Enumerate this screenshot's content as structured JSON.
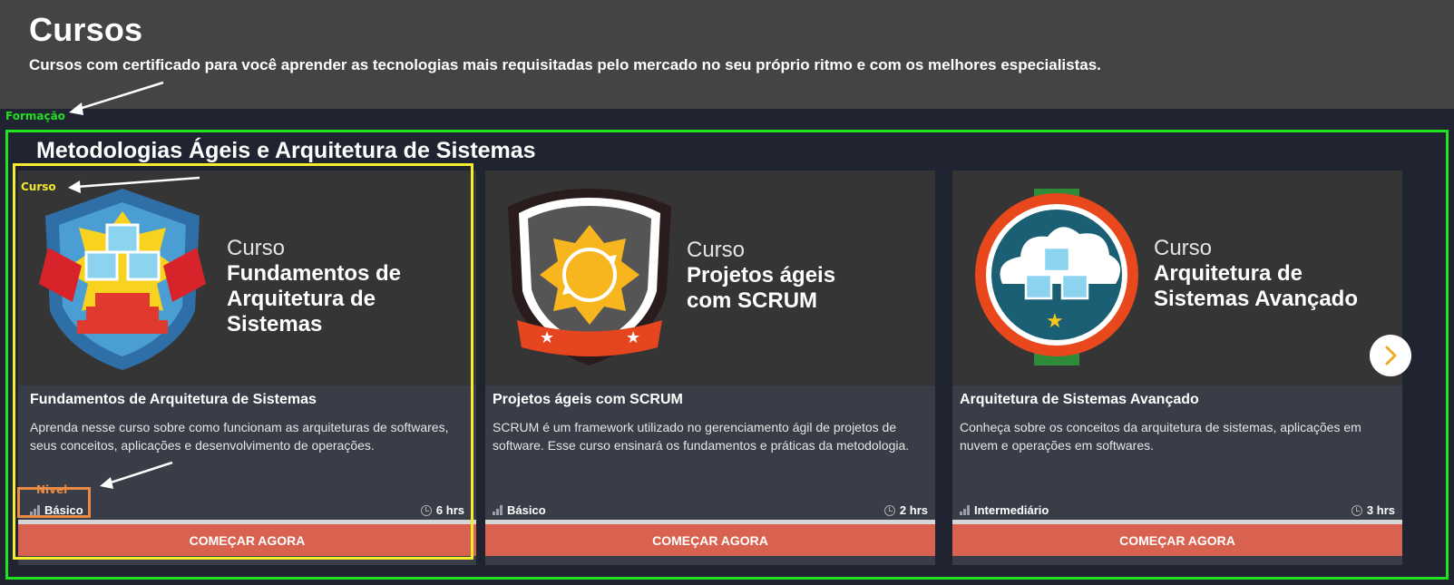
{
  "header": {
    "title": "Cursos",
    "subtitle": "Cursos com certificado para você aprender as tecnologias mais requisitadas pelo mercado no seu próprio ritmo e com os melhores especialistas."
  },
  "annotations": {
    "formacao": "Formação",
    "curso": "Curso",
    "nivel": "Nivel"
  },
  "section": {
    "title": "Metodologias Ágeis e Arquitetura de Sistemas"
  },
  "cards": [
    {
      "media_kicker": "Curso",
      "media_name": "Fundamentos de Arquitetura de Sistemas",
      "title": "Fundamentos de Arquitetura de Sistemas",
      "description": "Aprenda nesse curso sobre como funcionam as arquiteturas de softwares, seus conceitos, aplicações e desenvolvimento de operações.",
      "level": "Básico",
      "duration": "6 hrs",
      "cta": "COMEÇAR AGORA",
      "badge_icon": "architecture-shield-icon"
    },
    {
      "media_kicker": "Curso",
      "media_name": "Projetos ágeis com SCRUM",
      "title": "Projetos ágeis com SCRUM",
      "description": "SCRUM é um framework utilizado no gerenciamento ágil de projetos de software. Esse curso ensinará os fundamentos e práticas da metodologia.",
      "level": "Básico",
      "duration": "2 hrs",
      "cta": "COMEÇAR AGORA",
      "badge_icon": "scrum-shield-icon"
    },
    {
      "media_kicker": "Curso",
      "media_name": "Arquitetura de Sistemas Avançado",
      "title": "Arquitetura de Sistemas Avançado",
      "description": "Conheça sobre os conceitos da arquitetura de sistemas, aplicações em nuvem e operações em softwares.",
      "level": "Intermediário",
      "duration": "3 hrs",
      "cta": "COMEÇAR AGORA",
      "badge_icon": "cloud-architecture-badge-icon"
    }
  ],
  "colors": {
    "header_bg": "#444444",
    "page_bg": "#1f2430",
    "card_bg": "#383d48",
    "cta_bg": "#d9614f",
    "formacao_annotation": "#1ee31e",
    "curso_annotation": "#f3ed2d",
    "nivel_annotation": "#e98b44",
    "next_arrow": "#f0a830"
  },
  "carousel": {
    "next_icon": "chevron-right-icon"
  }
}
